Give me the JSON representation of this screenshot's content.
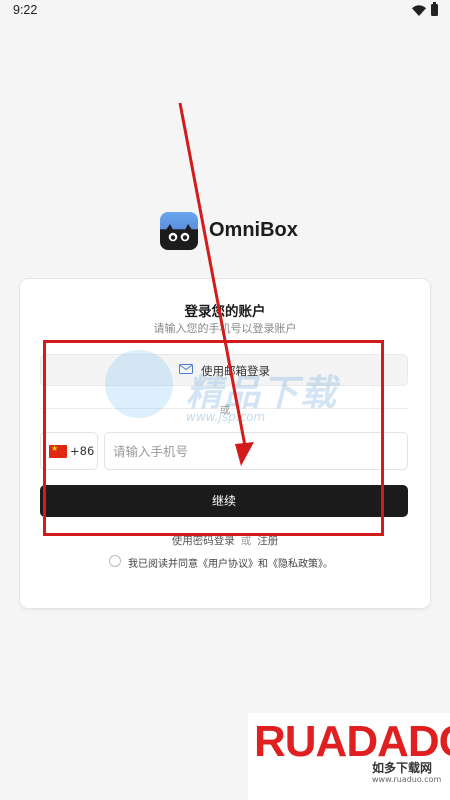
{
  "status_bar": {
    "time": "9:22"
  },
  "brand": {
    "name": "OmniBox"
  },
  "login": {
    "title": "登录您的账户",
    "subtitle": "请输入您的手机号以登录账户",
    "email_button": "使用邮箱登录",
    "or": "或",
    "country_code": "+86",
    "phone_placeholder": "请输入手机号",
    "continue_button": "继续",
    "password_login": "使用密码登录",
    "or_inline": "或",
    "register": "注册",
    "agreement": "我已阅读并同意《用户协议》和《隐私政策》。"
  },
  "watermarks": {
    "jsp_cn": "精品下载",
    "jsp_url": "www.jsp.com",
    "ruadado_text": "RUADADO",
    "ruadado_cn": "如多下载网",
    "ruadado_url": "www.ruaduo.com"
  },
  "colors": {
    "background": "#f5f5f5",
    "primary_button": "#1b1b1b",
    "annotation_red": "#d21b1b"
  }
}
